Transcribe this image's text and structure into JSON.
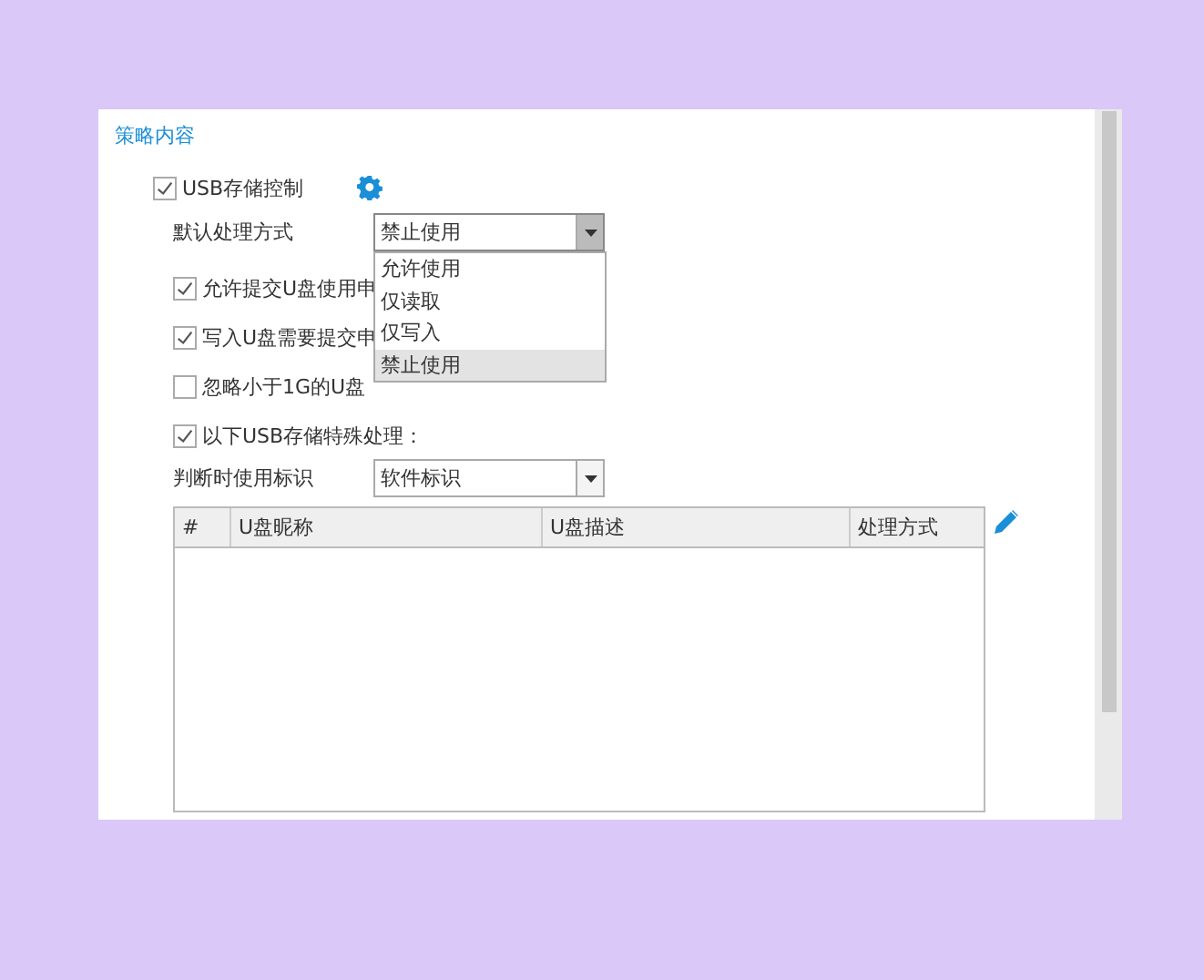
{
  "section_title": "策略内容",
  "usb_control": {
    "label": "USB存储控制",
    "checked": true
  },
  "default_action": {
    "label": "默认处理方式",
    "value": "禁止使用",
    "expanded": true,
    "options": [
      {
        "label": "允许使用",
        "selected": false
      },
      {
        "label": "仅读取",
        "selected": false
      },
      {
        "label": "仅写入",
        "selected": false
      },
      {
        "label": "禁止使用",
        "selected": true
      }
    ]
  },
  "options": [
    {
      "label": "允许提交U盘使用申",
      "checked": true
    },
    {
      "label": "写入U盘需要提交申",
      "checked": true
    },
    {
      "label": "忽略小于1G的U盘",
      "checked": false
    },
    {
      "label": "以下USB存储特殊处理：",
      "checked": true
    }
  ],
  "identify": {
    "label": "判断时使用标识",
    "value": "软件标识"
  },
  "table": {
    "columns": [
      "#",
      "U盘昵称",
      "U盘描述",
      "处理方式"
    ]
  }
}
